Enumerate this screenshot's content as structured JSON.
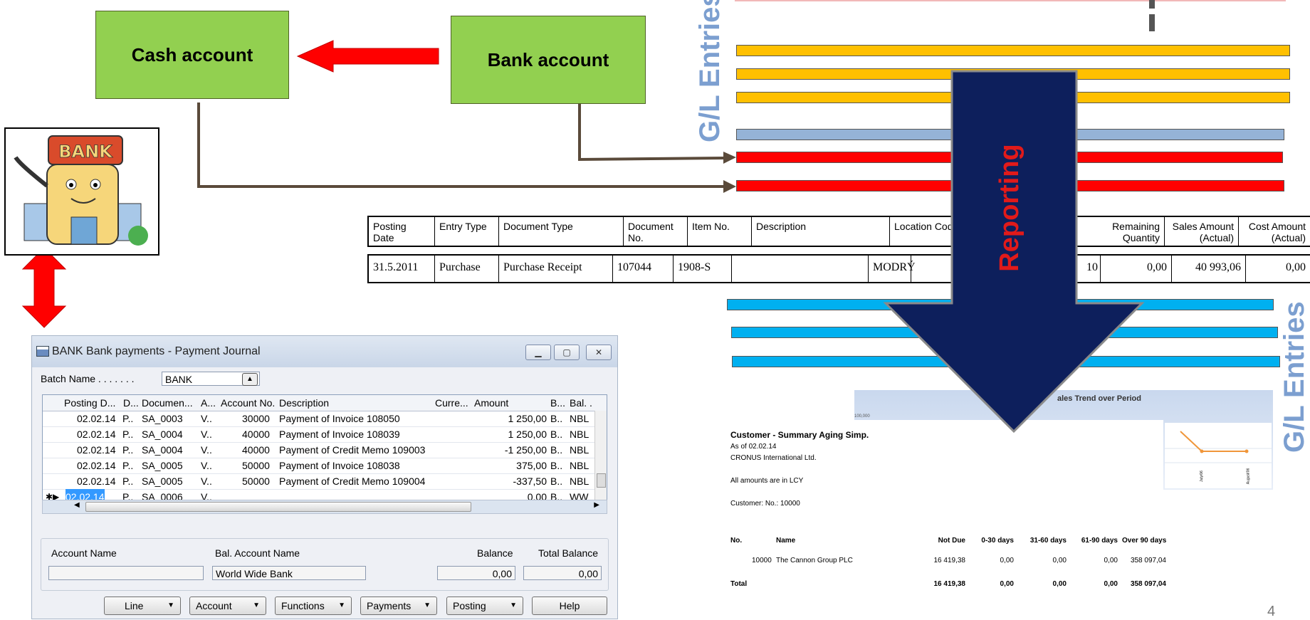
{
  "diagram": {
    "cash_account": "Cash account",
    "bank_account": "Bank account",
    "gl_entries_top": "G/L Entries",
    "gl_entries_right": "G/L Entries",
    "reporting": "Reporting",
    "bank_sign": "BANK",
    "page_number": "4",
    "colors": {
      "green": "#92d050",
      "red": "#ff0000",
      "orange": "#ffc000",
      "light_blue": "#95b3d7",
      "cyan": "#00b0f0",
      "navy": "#0d1f5c",
      "gl_text": "#7c9fd0",
      "connector": "#5a4a3a"
    }
  },
  "item_ledger": {
    "headers": [
      "Posting Date",
      "Entry Type",
      "Document Type",
      "Document No.",
      "Item No.",
      "Description",
      "Location Code",
      "Remaining Quantity",
      "Sales Amount (Actual)",
      "Cost Amount (Actual)"
    ],
    "row": {
      "posting_date": "31.5.2011",
      "entry_type": "Purchase",
      "document_type": "Purchase Receipt",
      "document_no": "107044",
      "item_no": "1908-S",
      "description": "",
      "location_code": "MODRÝ",
      "quantity": "10",
      "invoiced_quantity": "10",
      "remaining_quantity": "0,00",
      "sales_amount": "40 993,06",
      "cost_amount": "0,00"
    }
  },
  "journal": {
    "title": "BANK Bank payments - Payment Journal",
    "batch_label": "Batch Name . . . . . . .",
    "batch_value": "BANK",
    "columns": [
      "Posting D...",
      "D...",
      "Documen...",
      "A...",
      "Account No.",
      "Description",
      "Curre...",
      "Amount",
      "B...",
      "Bal. ."
    ],
    "rows": [
      {
        "date": "02.02.14",
        "doctype": "P..",
        "docno": "SA_0003",
        "acctype": "V..",
        "accno": "30000",
        "desc": "Payment of Invoice 108050",
        "cur": "",
        "amount": "1 250,00",
        "baltype": "B..",
        "bal": "NBL"
      },
      {
        "date": "02.02.14",
        "doctype": "P..",
        "docno": "SA_0004",
        "acctype": "V..",
        "accno": "40000",
        "desc": "Payment of Invoice 108039",
        "cur": "",
        "amount": "1 250,00",
        "baltype": "B..",
        "bal": "NBL"
      },
      {
        "date": "02.02.14",
        "doctype": "P..",
        "docno": "SA_0004",
        "acctype": "V..",
        "accno": "40000",
        "desc": "Payment of Credit Memo 109003",
        "cur": "",
        "amount": "-1 250,00",
        "baltype": "B..",
        "bal": "NBL"
      },
      {
        "date": "02.02.14",
        "doctype": "P..",
        "docno": "SA_0005",
        "acctype": "V..",
        "accno": "50000",
        "desc": "Payment of Invoice 108038",
        "cur": "",
        "amount": "375,00",
        "baltype": "B..",
        "bal": "NBL"
      },
      {
        "date": "02.02.14",
        "doctype": "P..",
        "docno": "SA_0005",
        "acctype": "V..",
        "accno": "50000",
        "desc": "Payment of Credit Memo 109004",
        "cur": "",
        "amount": "-337,50",
        "baltype": "B..",
        "bal": "NBL"
      },
      {
        "date": "02.02.14",
        "doctype": "P..",
        "docno": "SA_0006",
        "acctype": "V..",
        "accno": "",
        "desc": "",
        "cur": "",
        "amount": "0,00",
        "baltype": "B..",
        "bal": "WW"
      }
    ],
    "footer": {
      "account_name_label": "Account Name",
      "account_name_value": "",
      "bal_account_name_label": "Bal. Account Name",
      "bal_account_name_value": "World Wide Bank",
      "balance_label": "Balance",
      "balance_value": "0,00",
      "total_balance_label": "Total Balance",
      "total_balance_value": "0,00"
    },
    "buttons": [
      "Line",
      "Account",
      "Functions",
      "Payments",
      "Posting",
      "Help"
    ]
  },
  "report": {
    "chart_title": "ales Trend over Period",
    "chart_axis_top": "100,000",
    "chart_x_labels": [
      "July/06",
      "August/06"
    ],
    "title": "Customer - Summary Aging Simp.",
    "as_of": "As of 02.02.14",
    "company": "CRONUS International Ltd.",
    "currency_note": "All amounts are in LCY",
    "filter": "Customer: No.: 10000",
    "headers": [
      "No.",
      "Name",
      "Not Due",
      "0-30 days",
      "31-60 days",
      "61-90 days",
      "Over 90 days"
    ],
    "row": {
      "no": "10000",
      "name": "The Cannon Group PLC",
      "not_due": "16 419,38",
      "d0_30": "0,00",
      "d31_60": "0,00",
      "d61_90": "0,00",
      "over90": "358 097,04"
    },
    "total": {
      "label": "Total",
      "not_due": "16 419,38",
      "d0_30": "0,00",
      "d31_60": "0,00",
      "d61_90": "0,00",
      "over90": "358 097,04"
    }
  }
}
